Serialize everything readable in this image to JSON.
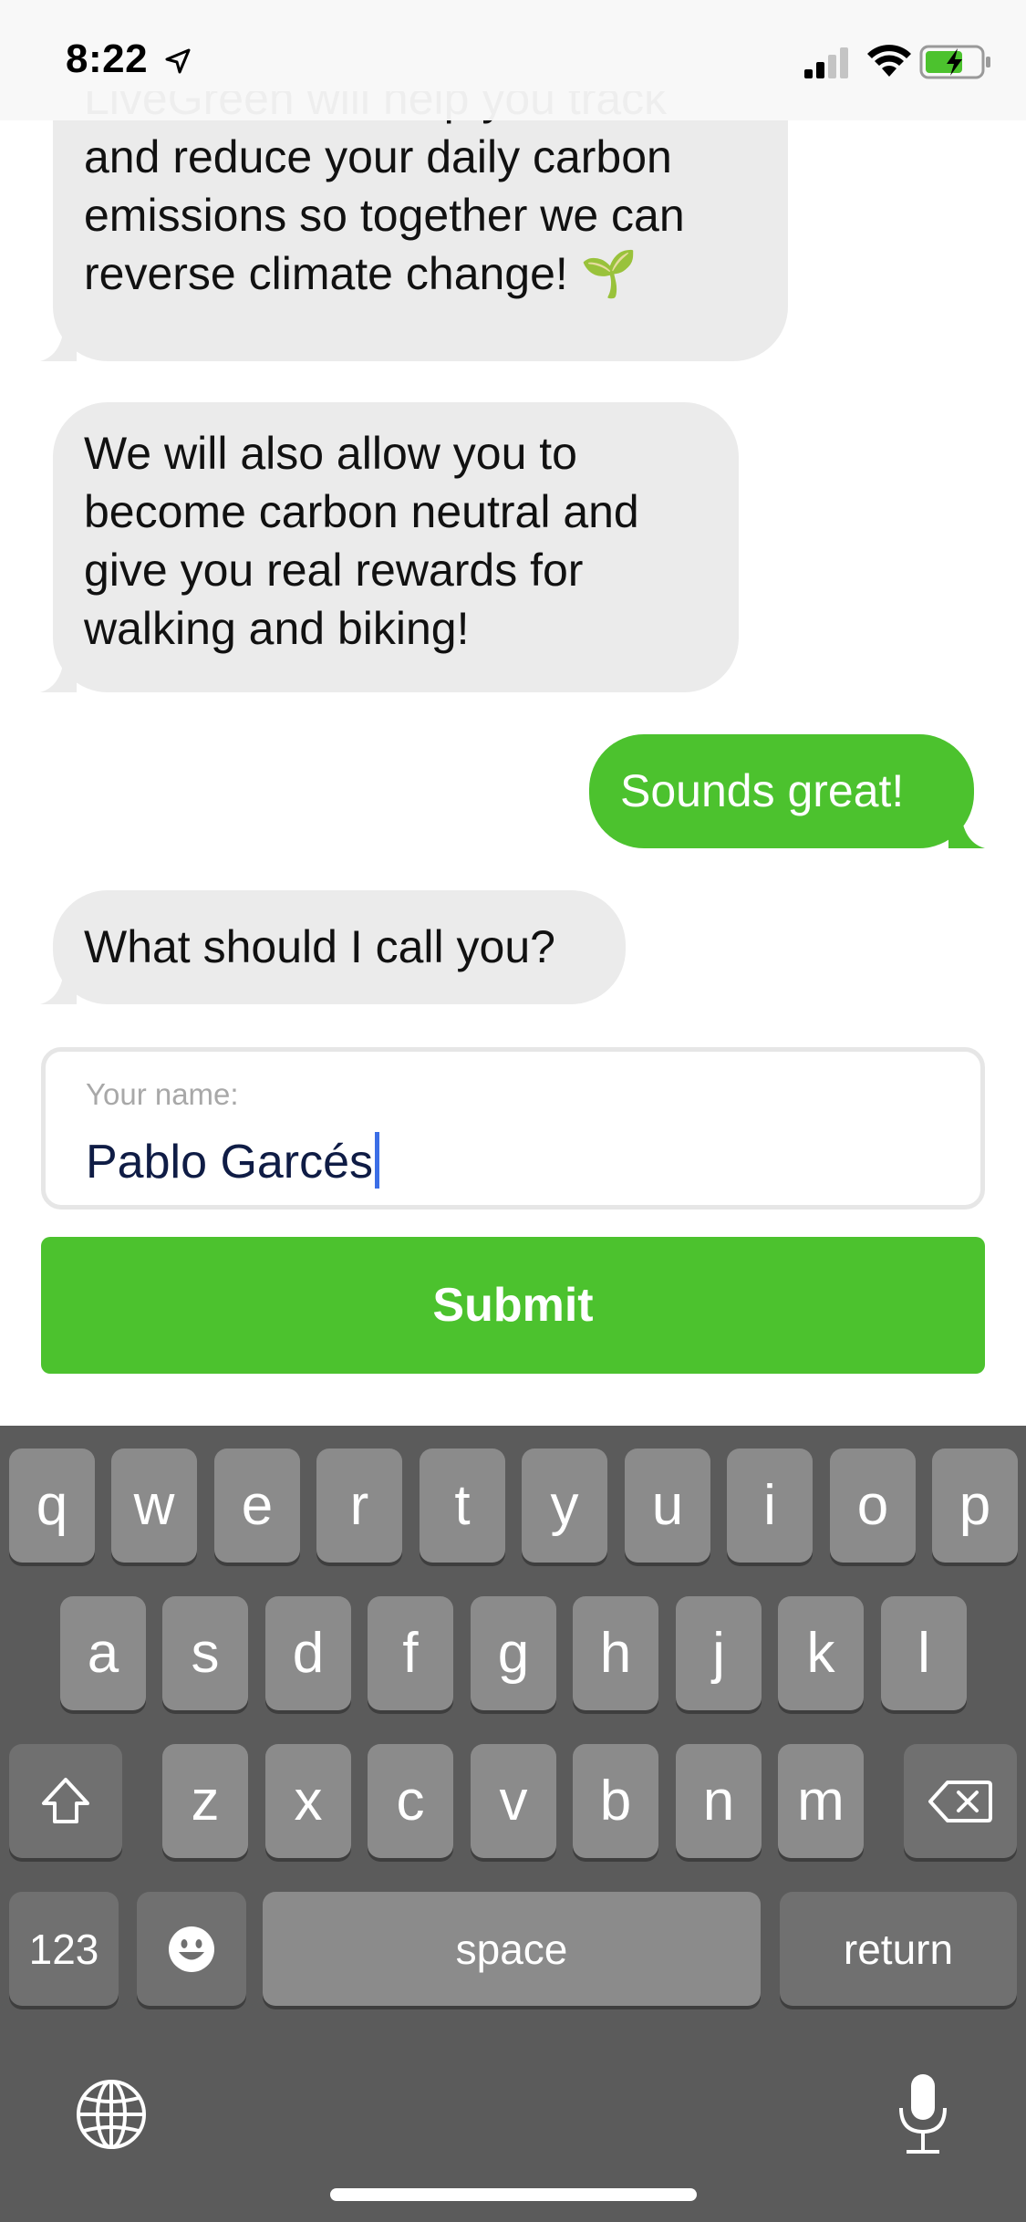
{
  "status_bar": {
    "time": "8:22"
  },
  "messages": [
    {
      "from": "bot",
      "lines": [
        "LiveGreen will help you track",
        "and reduce your daily carbon",
        "emissions so together we can",
        "reverse climate change! 🌱"
      ]
    },
    {
      "from": "bot",
      "lines": [
        "We will also allow you to",
        "become carbon neutral and",
        "give you real rewards for",
        "walking and biking!"
      ]
    },
    {
      "from": "user",
      "lines": [
        "Sounds great!"
      ]
    },
    {
      "from": "bot",
      "lines": [
        "What should I call you?"
      ]
    }
  ],
  "name_field": {
    "label": "Your name:",
    "value": "Pablo Garcés"
  },
  "submit_label": "Submit",
  "keyboard": {
    "row1": [
      "q",
      "w",
      "e",
      "r",
      "t",
      "y",
      "u",
      "i",
      "o",
      "p"
    ],
    "row2": [
      "a",
      "s",
      "d",
      "f",
      "g",
      "h",
      "j",
      "k",
      "l"
    ],
    "row3": [
      "z",
      "x",
      "c",
      "v",
      "b",
      "n",
      "m"
    ],
    "numbers_label": "123",
    "space_label": "space",
    "return_label": "return",
    "icons": [
      "shift-icon",
      "delete-icon",
      "emoji-icon",
      "globe-icon",
      "microphone-icon"
    ]
  },
  "colors": {
    "accent_green": "#4cc22e",
    "bubble_gray": "#ebebeb",
    "keyboard_bg": "#5b5b5b"
  }
}
